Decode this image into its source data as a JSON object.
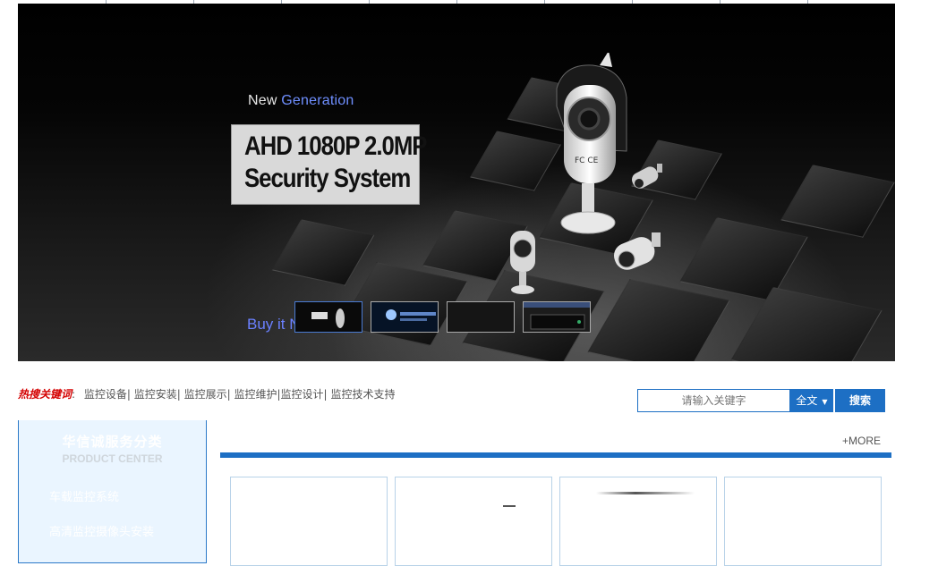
{
  "banner": {
    "tag_prefix": "New",
    "tag_accent": "Generation",
    "title_line1": "AHD 1080P 2.0MP",
    "title_line2": "Security System",
    "buy_text": "Buy it N",
    "camera_label": "FC CE",
    "thumbnails": [
      {
        "name": "banner-slide-1",
        "active": true
      },
      {
        "name": "banner-slide-2",
        "active": false
      },
      {
        "name": "banner-slide-3",
        "active": false
      },
      {
        "name": "banner-slide-4",
        "active": false
      }
    ]
  },
  "hotwords": {
    "label": "热搜关键词",
    "separator": ":",
    "items": [
      "监控设备|",
      "监控安装|",
      "监控展示|",
      "监控维护|监控设计|",
      "监控技术支持"
    ]
  },
  "search": {
    "placeholder": "请输入关键字",
    "scope_label": "全文",
    "scope_arrow": "▼",
    "button_label": "搜索"
  },
  "sidebar": {
    "title_cn": "华信诚服务分类",
    "title_en": "PRODUCT CENTER",
    "items": [
      "车载监控系统",
      "高清监控摄像头安装"
    ]
  },
  "products": {
    "more_label": "+MORE"
  },
  "colors": {
    "accent": "#1d6fc4",
    "hotword_label": "#d40000",
    "banner_text_accent": "#6f8fff"
  }
}
